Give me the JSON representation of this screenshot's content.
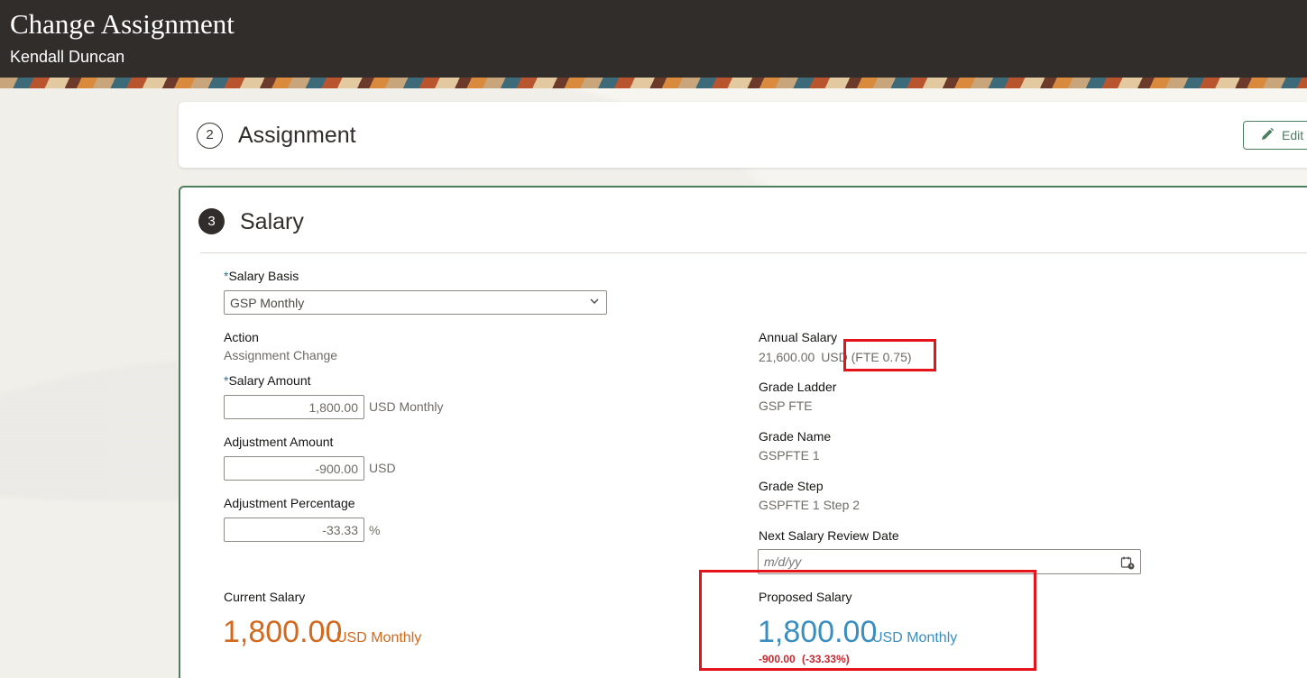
{
  "header": {
    "title": "Change Assignment",
    "subtitle": "Kendall Duncan"
  },
  "assignment_section": {
    "step_number": "2",
    "title": "Assignment",
    "edit_label": "Edit"
  },
  "salary_section": {
    "step_number": "3",
    "title": "Salary",
    "salary_basis": {
      "required_mark": "*",
      "label": "Salary Basis",
      "value": "GSP Monthly"
    },
    "action": {
      "label": "Action",
      "value": "Assignment Change"
    },
    "salary_amount": {
      "required_mark": "*",
      "label": "Salary Amount",
      "value": "1,800.00",
      "unit": "USD Monthly"
    },
    "adjustment_amount": {
      "label": "Adjustment Amount",
      "value": "-900.00",
      "unit": "USD"
    },
    "adjustment_percentage": {
      "label": "Adjustment Percentage",
      "value": "-33.33",
      "unit": "%"
    },
    "annual_salary": {
      "label": "Annual Salary",
      "value": "21,600.00",
      "currency": "USD",
      "fte": "(FTE 0.75)"
    },
    "grade_ladder": {
      "label": "Grade Ladder",
      "value": "GSP FTE"
    },
    "grade_name": {
      "label": "Grade Name",
      "value": "GSPFTE 1"
    },
    "grade_step": {
      "label": "Grade Step",
      "value": "GSPFTE 1 Step 2"
    },
    "next_review_date": {
      "label": "Next Salary Review Date",
      "placeholder": "m/d/yy"
    },
    "current_salary": {
      "label": "Current Salary",
      "amount": "1,800.00",
      "unit": "USD Monthly"
    },
    "proposed_salary": {
      "label": "Proposed Salary",
      "amount": "1,800.00",
      "unit": "USD Monthly",
      "change_amount": "-900.00",
      "change_percent": "(-33.33%)"
    }
  },
  "colors": {
    "header_bg": "#312d2a",
    "accent_green": "#4d7e5f",
    "current_salary": "#d2691e",
    "proposed_salary": "#3a8fc0",
    "negative_delta": "#c22b32",
    "annotation_red": "#e5141a"
  }
}
